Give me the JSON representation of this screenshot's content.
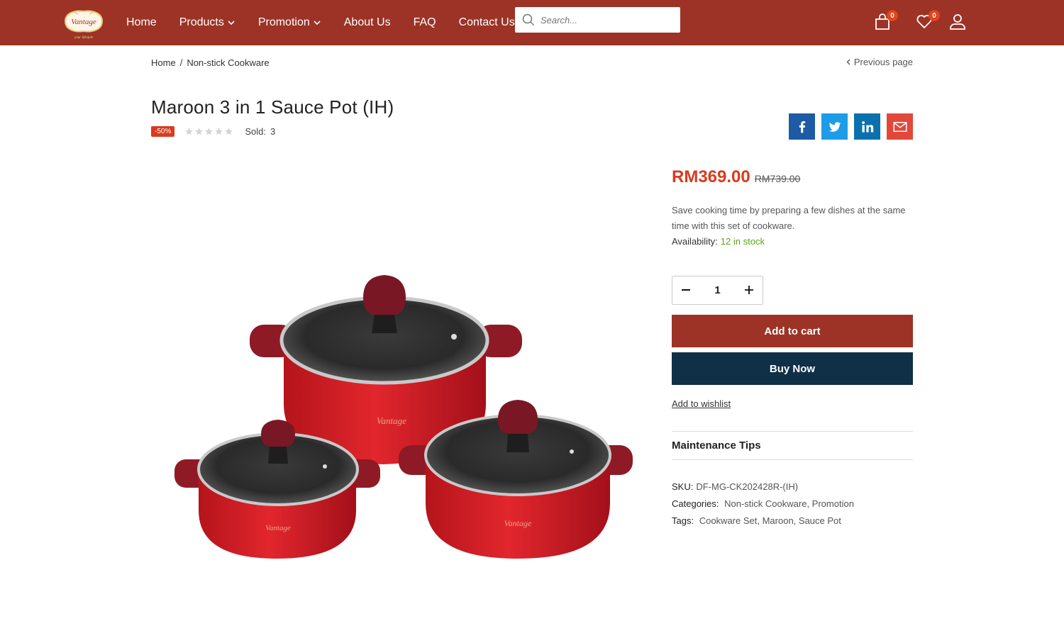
{
  "brand": {
    "logo_text": "Vantage",
    "logo_tagline": "your lifestyle"
  },
  "nav": {
    "items": [
      {
        "label": "Home",
        "dropdown": false
      },
      {
        "label": "Products",
        "dropdown": true
      },
      {
        "label": "Promotion",
        "dropdown": true
      },
      {
        "label": "About Us",
        "dropdown": false
      },
      {
        "label": "FAQ",
        "dropdown": false
      },
      {
        "label": "Contact Us",
        "dropdown": false
      }
    ]
  },
  "search": {
    "placeholder": "Search..."
  },
  "header_icons": {
    "cart_count": "0",
    "wishlist_count": "0"
  },
  "breadcrumb": {
    "home": "Home",
    "separator": "/",
    "current": "Non-stick Cookware"
  },
  "previous_page": "Previous page",
  "product": {
    "title": "Maroon 3 in 1 Sauce Pot (IH)",
    "discount": "-50%",
    "rating": 0,
    "sold_label": "Sold:",
    "sold_value": "3",
    "price": "RM369.00",
    "old_price": "RM739.00",
    "description": "Save cooking time by preparing a few dishes at the same time with this set of cookware.",
    "availability_label": "Availability:",
    "availability_value": "12 in stock",
    "quantity": "1",
    "add_to_cart": "Add to cart",
    "buy_now": "Buy Now",
    "add_to_wishlist": "Add to wishlist",
    "maintenance_tips": "Maintenance Tips",
    "sku_label": "SKU:",
    "sku_value": "DF-MG-CK202428R-(IH)",
    "categories_label": "Categories:",
    "categories": [
      "Non-stick Cookware",
      "Promotion"
    ],
    "tags_label": "Tags:",
    "tags": [
      "Cookware Set",
      "Maroon",
      "Sauce Pot"
    ]
  },
  "share": [
    "facebook-icon",
    "twitter-icon",
    "linkedin-icon",
    "email-icon"
  ],
  "colors": {
    "header": "#9c3326",
    "price": "#d83b1d",
    "stock": "#5aa61b",
    "buy_now": "#0f3046",
    "facebook": "#1d5ba6",
    "twitter": "#1d9ce8",
    "linkedin": "#0b71ae",
    "email": "#e2483a"
  }
}
